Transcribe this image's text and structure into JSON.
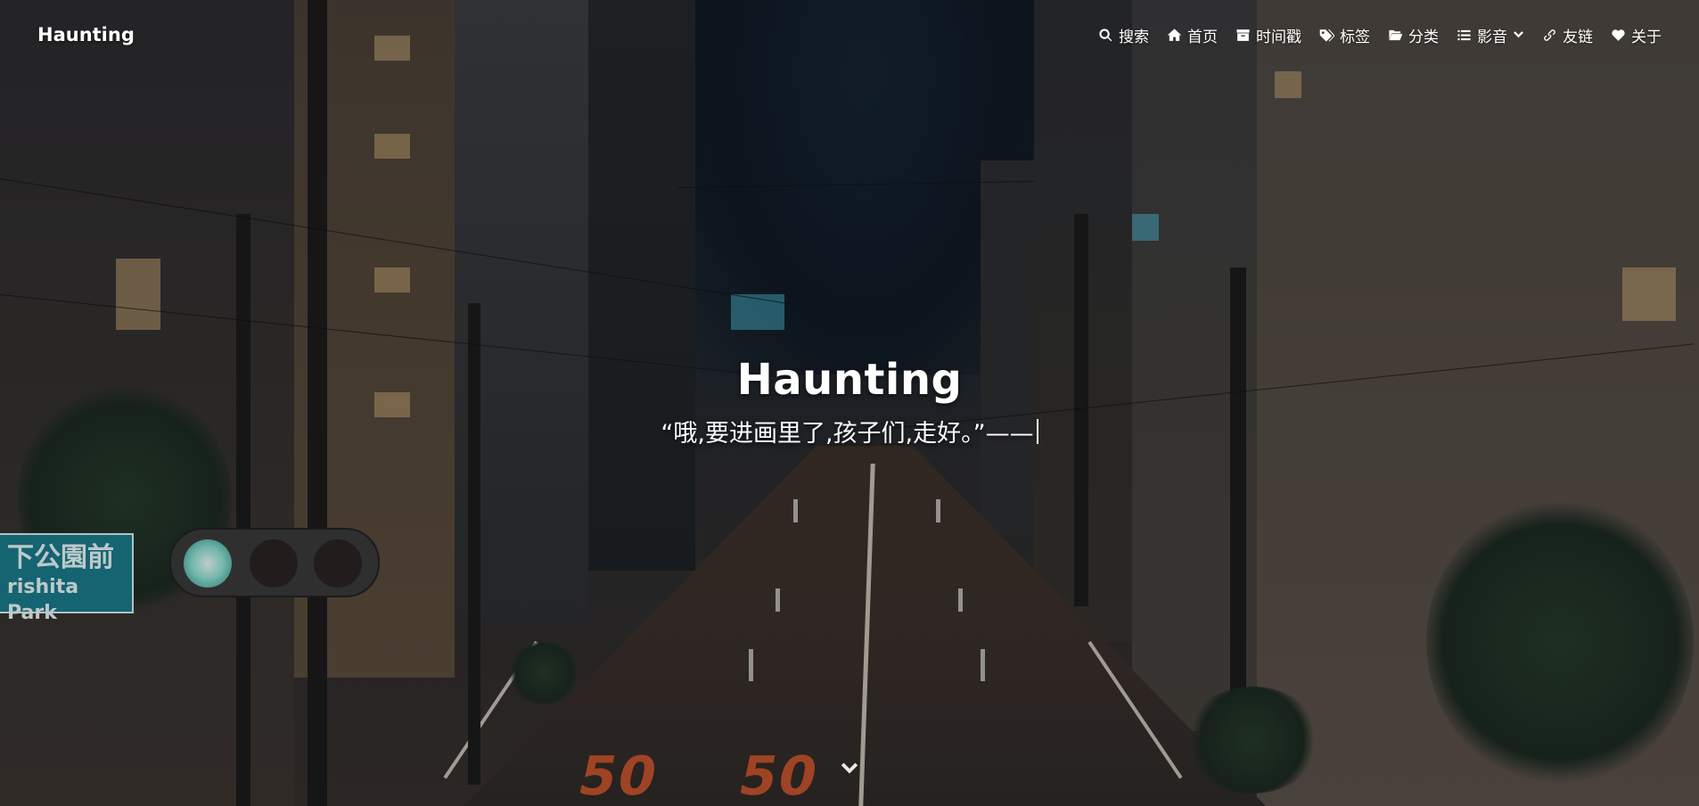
{
  "nav": {
    "brand": "Haunting",
    "items": [
      {
        "label": "搜索",
        "icon": "search-icon"
      },
      {
        "label": "首页",
        "icon": "home-icon"
      },
      {
        "label": "时间戳",
        "icon": "archive-icon"
      },
      {
        "label": "标签",
        "icon": "tags-icon"
      },
      {
        "label": "分类",
        "icon": "folder-open-icon"
      },
      {
        "label": "影音",
        "icon": "list-icon",
        "dropdown": true
      },
      {
        "label": "友链",
        "icon": "link-icon"
      },
      {
        "label": "关于",
        "icon": "heart-icon"
      }
    ]
  },
  "hero": {
    "title": "Haunting",
    "subtitle": "“哦,要进画里了,孩子们,走好。”——",
    "scroll_icon": "chevron-down-icon"
  },
  "background": {
    "road_marking_left": "50",
    "road_marking_right": "50",
    "street_sign_top": "下公園前",
    "street_sign_bottom": "rishita Park"
  }
}
